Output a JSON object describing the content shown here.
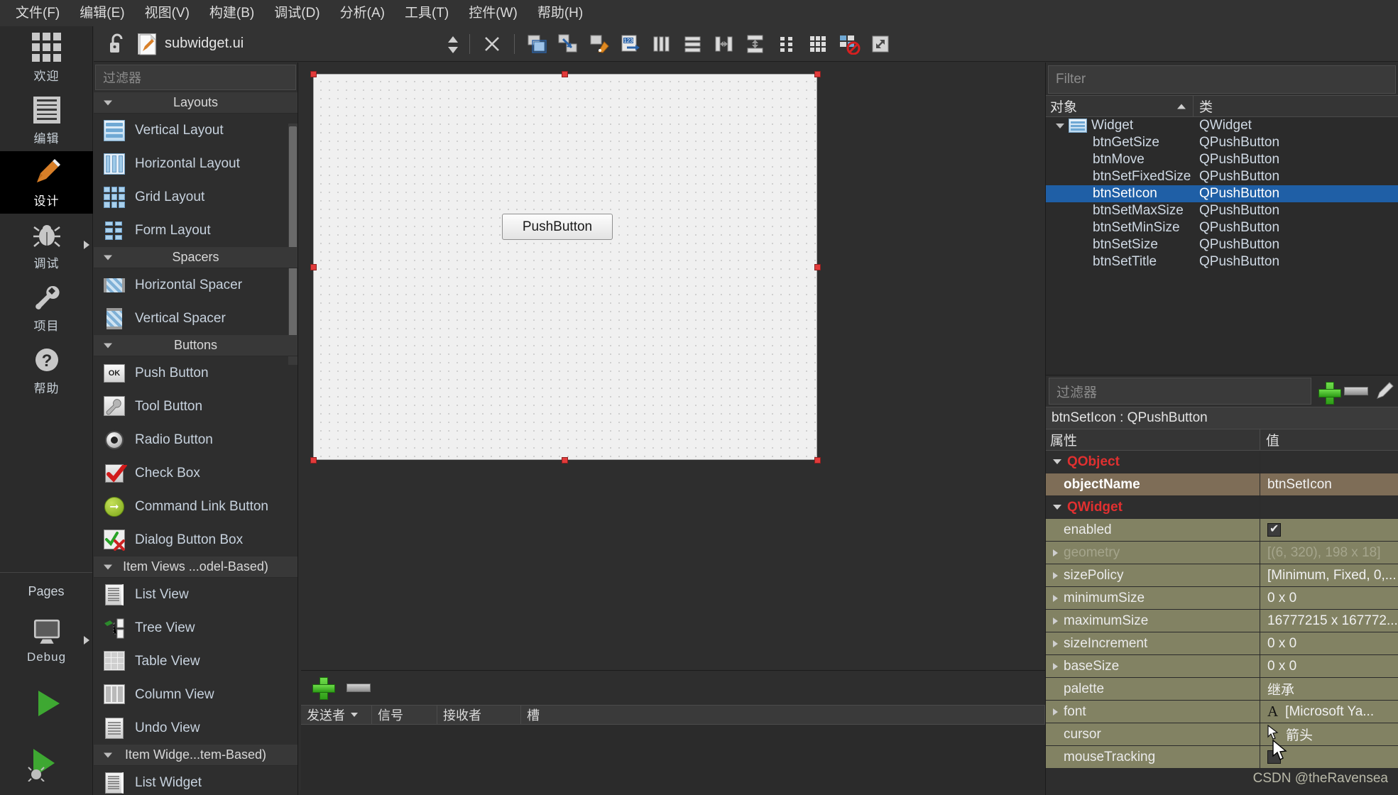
{
  "menubar": {
    "items": [
      {
        "label": "文件(F)",
        "name": "menu-file"
      },
      {
        "label": "编辑(E)",
        "name": "menu-edit"
      },
      {
        "label": "视图(V)",
        "name": "menu-view"
      },
      {
        "label": "构建(B)",
        "name": "menu-build"
      },
      {
        "label": "调试(D)",
        "name": "menu-debug"
      },
      {
        "label": "分析(A)",
        "name": "menu-analyze"
      },
      {
        "label": "工具(T)",
        "name": "menu-tools"
      },
      {
        "label": "控件(W)",
        "name": "menu-widgets"
      },
      {
        "label": "帮助(H)",
        "name": "menu-help"
      }
    ]
  },
  "modebar": {
    "items": [
      {
        "label": "欢迎",
        "icon": "grid-icon",
        "active": false
      },
      {
        "label": "编辑",
        "icon": "document-lines-icon",
        "active": false
      },
      {
        "label": "设计",
        "icon": "pencil-icon",
        "active": true
      },
      {
        "label": "调试",
        "icon": "bug-icon",
        "active": false,
        "arrow": true
      },
      {
        "label": "项目",
        "icon": "wrench-icon",
        "active": false
      },
      {
        "label": "帮助",
        "icon": "question-circle-icon",
        "active": false
      }
    ],
    "pages_label": "Pages",
    "debug_label": "Debug",
    "debug_icon": "monitor-icon"
  },
  "filetoolbar": {
    "lock_icon": "unlocked-padlock-icon",
    "file_icon": "ui-file-icon",
    "filename": "subwidget.ui",
    "spin_icon": "updown-arrows-icon",
    "close_icon": "close-x-icon",
    "buttons": [
      {
        "name": "edit-widgets-icon",
        "title": "编辑控件"
      },
      {
        "name": "edit-signals-slots-icon",
        "title": "编辑信号槽"
      },
      {
        "name": "edit-buddies-icon",
        "title": "编辑伙伴"
      },
      {
        "name": "edit-tab-order-icon",
        "title": "编辑 Tab 顺序"
      },
      {
        "name": "layout-horizontally-icon",
        "title": "水平布局"
      },
      {
        "name": "layout-vertically-icon",
        "title": "垂直布局"
      },
      {
        "name": "layout-splitter-h-icon",
        "title": "水平分裂器布局"
      },
      {
        "name": "layout-splitter-v-icon",
        "title": "垂直分裂器布局"
      },
      {
        "name": "layout-form-icon",
        "title": "表单布局"
      },
      {
        "name": "layout-grid-icon",
        "title": "栅格布局"
      },
      {
        "name": "break-layout-icon",
        "title": "打破布局"
      },
      {
        "name": "adjust-size-icon",
        "title": "调整大小"
      }
    ]
  },
  "widgetbox": {
    "filter_placeholder": "过滤器",
    "sections": [
      {
        "title": "Layouts",
        "items": [
          {
            "label": "Vertical Layout",
            "icon": "vertical-layout-icon"
          },
          {
            "label": "Horizontal Layout",
            "icon": "horizontal-layout-icon"
          },
          {
            "label": "Grid Layout",
            "icon": "grid-layout-icon"
          },
          {
            "label": "Form Layout",
            "icon": "form-layout-icon"
          }
        ]
      },
      {
        "title": "Spacers",
        "items": [
          {
            "label": "Horizontal Spacer",
            "icon": "horizontal-spacer-icon"
          },
          {
            "label": "Vertical Spacer",
            "icon": "vertical-spacer-icon"
          }
        ]
      },
      {
        "title": "Buttons",
        "items": [
          {
            "label": "Push Button",
            "icon": "push-button-icon"
          },
          {
            "label": "Tool Button",
            "icon": "tool-button-icon"
          },
          {
            "label": "Radio Button",
            "icon": "radio-button-icon"
          },
          {
            "label": "Check Box",
            "icon": "check-box-icon"
          },
          {
            "label": "Command Link Button",
            "icon": "command-link-button-icon"
          },
          {
            "label": "Dialog Button Box",
            "icon": "dialog-button-box-icon"
          }
        ]
      },
      {
        "title": "Item Views ...odel-Based)",
        "items": [
          {
            "label": "List View",
            "icon": "list-view-icon"
          },
          {
            "label": "Tree View",
            "icon": "tree-view-icon"
          },
          {
            "label": "Table View",
            "icon": "table-view-icon"
          },
          {
            "label": "Column View",
            "icon": "column-view-icon"
          },
          {
            "label": "Undo View",
            "icon": "undo-view-icon"
          }
        ]
      },
      {
        "title": "Item Widge...tem-Based)",
        "items": [
          {
            "label": "List Widget",
            "icon": "list-widget-icon"
          }
        ]
      }
    ]
  },
  "form": {
    "pushbutton_text": "PushButton",
    "selection_handles": 8
  },
  "slot_editor": {
    "add_icon": "plus-icon",
    "remove_icon": "minus-icon",
    "columns": [
      "发送者",
      "信号",
      "接收者",
      "槽"
    ],
    "rows": []
  },
  "object_inspector": {
    "filter_placeholder": "Filter",
    "columns": [
      "对象",
      "类"
    ],
    "rows": [
      {
        "name": "Widget",
        "class": "QWidget",
        "root": true,
        "selected": false
      },
      {
        "name": "btnGetSize",
        "class": "QPushButton",
        "root": false,
        "selected": false
      },
      {
        "name": "btnMove",
        "class": "QPushButton",
        "root": false,
        "selected": false
      },
      {
        "name": "btnSetFixedSize",
        "class": "QPushButton",
        "root": false,
        "selected": false
      },
      {
        "name": "btnSetIcon",
        "class": "QPushButton",
        "root": false,
        "selected": true
      },
      {
        "name": "btnSetMaxSize",
        "class": "QPushButton",
        "root": false,
        "selected": false
      },
      {
        "name": "btnSetMinSize",
        "class": "QPushButton",
        "root": false,
        "selected": false
      },
      {
        "name": "btnSetSize",
        "class": "QPushButton",
        "root": false,
        "selected": false
      },
      {
        "name": "btnSetTitle",
        "class": "QPushButton",
        "root": false,
        "selected": false
      }
    ]
  },
  "property_editor": {
    "filter_placeholder": "过滤器",
    "add_icon": "plus-icon",
    "remove_icon": "minus-icon",
    "configure_icon": "pencil-icon",
    "object_title": "btnSetIcon : QPushButton",
    "columns": [
      "属性",
      "值"
    ],
    "rows": [
      {
        "key": "QObject",
        "value": "",
        "style": "group",
        "expander": "down"
      },
      {
        "key": "objectName",
        "value": "btnSetIcon",
        "style": "brown",
        "expander": "none"
      },
      {
        "key": "QWidget",
        "value": "",
        "style": "group",
        "expander": "down"
      },
      {
        "key": "enabled",
        "value": "",
        "style": "olive",
        "expander": "none",
        "widget": "checkbox-checked"
      },
      {
        "key": "geometry",
        "value": "[(6, 320), 198 x 18]",
        "style": "olive dim",
        "expander": "right"
      },
      {
        "key": "sizePolicy",
        "value": "[Minimum, Fixed, 0,...",
        "style": "olive",
        "expander": "right"
      },
      {
        "key": "minimumSize",
        "value": "0 x 0",
        "style": "olive",
        "expander": "right"
      },
      {
        "key": "maximumSize",
        "value": "16777215 x 167772...",
        "style": "olive",
        "expander": "right"
      },
      {
        "key": "sizeIncrement",
        "value": "0 x 0",
        "style": "olive",
        "expander": "right"
      },
      {
        "key": "baseSize",
        "value": "0 x 0",
        "style": "olive",
        "expander": "right"
      },
      {
        "key": "palette",
        "value": "继承",
        "style": "olive",
        "expander": "none"
      },
      {
        "key": "font",
        "value": "[Microsoft Ya...",
        "style": "olive",
        "expander": "right",
        "widget": "font-A-icon"
      },
      {
        "key": "cursor",
        "value": "箭头",
        "style": "olive",
        "expander": "none",
        "widget": "arrow-cursor-icon"
      },
      {
        "key": "mouseTracking",
        "value": "",
        "style": "olive",
        "expander": "none",
        "widget": "checkbox-unchecked"
      }
    ]
  },
  "watermark": "CSDN @theRavensea",
  "colors": {
    "selection_blue": "#1f5fa6",
    "handle_red": "#e23b3b",
    "group_red": "#e03030",
    "brown_row": "#7e6d57",
    "olive_row": "#828263",
    "accent_orange": "#d87f28"
  }
}
